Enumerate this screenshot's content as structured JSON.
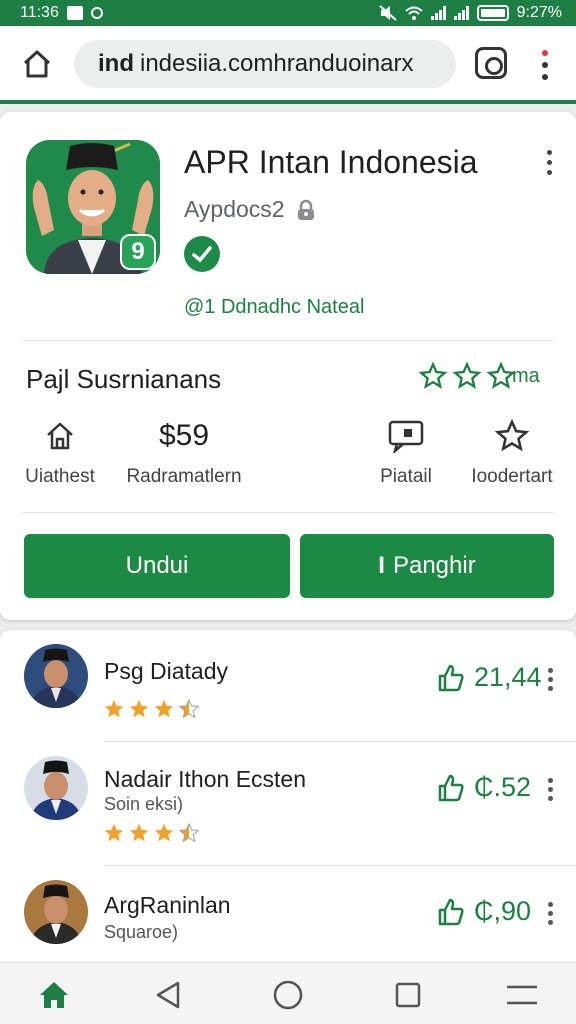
{
  "status_bar": {
    "time": "11:36",
    "battery": "9:27%"
  },
  "browser": {
    "url_strong": "ind",
    "url_rest": "indesiia.comhranduoinarx"
  },
  "app": {
    "title": "APR Intan Indonesia",
    "developer": "Aypdocs2",
    "tagline": "@1 Ddnadhc Nateal",
    "badge_text": "9"
  },
  "summary": {
    "title": "Pajl Susrnianans",
    "stars_text": "ma"
  },
  "stats": [
    {
      "icon": "home-icon",
      "label": "Uiathest"
    },
    {
      "value": "$59",
      "label": "Radramatlern"
    },
    {
      "icon": "tag-icon",
      "label": "Piatail"
    },
    {
      "icon": "star-icon",
      "label": "Ioodertart"
    }
  ],
  "buttons": {
    "primary": "Undui",
    "secondary": "Panghir",
    "secondary_icon_text": "I"
  },
  "reviews": [
    {
      "name": "Psg Diatady",
      "subtitle": "",
      "likes": "21,44",
      "rating": 3.5
    },
    {
      "name": "Nadair Ithon Ecsten",
      "subtitle": "Soin eksi)",
      "likes": "₵.52",
      "rating": 3.5
    },
    {
      "name": "ArgRaninlan",
      "subtitle": "Squaroе)",
      "likes": "₵,90",
      "rating": 0
    }
  ],
  "colors": {
    "brand": "#1d7f43",
    "button": "#1d8a44",
    "star": "#f0a32b"
  }
}
